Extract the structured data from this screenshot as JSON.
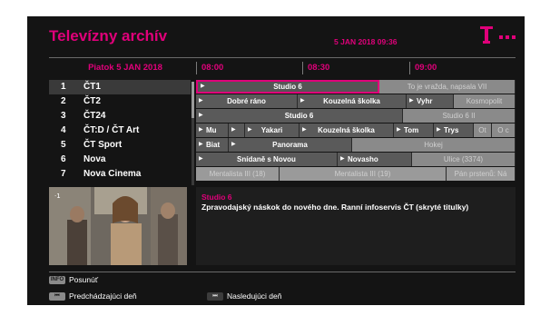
{
  "header": {
    "title": "Televízny archív",
    "datetime": "5 JAN 2018 09:36",
    "logo_icon": "telekom-t-logo-icon",
    "accent_color": "#e0007a"
  },
  "timeline": {
    "date": "Piatok 5 JAN 2018",
    "times": [
      "08:00",
      "08:30",
      "09:00"
    ]
  },
  "channels": [
    {
      "num": "1",
      "name": "ČT1",
      "selected": true
    },
    {
      "num": "2",
      "name": "ČT2"
    },
    {
      "num": "3",
      "name": "ČT24"
    },
    {
      "num": "4",
      "name": "ČT:D / ČT Art"
    },
    {
      "num": "5",
      "name": "ČT Sport"
    },
    {
      "num": "6",
      "name": "Nova"
    },
    {
      "num": "7",
      "name": "Nova Cinema"
    }
  ],
  "epg": {
    "rows": [
      [
        "Studio 6",
        "To je vražda, napsala VII"
      ],
      [
        "Dobré ráno",
        "Kouzelná školka",
        "Vyhr",
        "Kosmopolit"
      ],
      [
        "Studio 6",
        "Studio 6 II"
      ],
      [
        "Mu",
        "",
        "Yakari",
        "Kouzelná školka",
        "Tom",
        "Trys",
        "Ot",
        "O c"
      ],
      [
        "Biat",
        "Panorama",
        "Hokej"
      ],
      [
        "Snídaně s Novou",
        "Novasho",
        "Ulice (3374)"
      ],
      [
        "Mentalista III (18)",
        "Mentalista III (19)",
        "Pán prstenů: Ná"
      ]
    ]
  },
  "info": {
    "channel": "Studio 6",
    "description": "Zpravodajský náskok do nového dne. Ranní infoservis ČT (skryté titulky)"
  },
  "footer": {
    "info_key": "INFO",
    "info_label": "Posunúť",
    "prev_label": "Predchádzajúci deň",
    "next_label": "Nasledujúci deň"
  }
}
